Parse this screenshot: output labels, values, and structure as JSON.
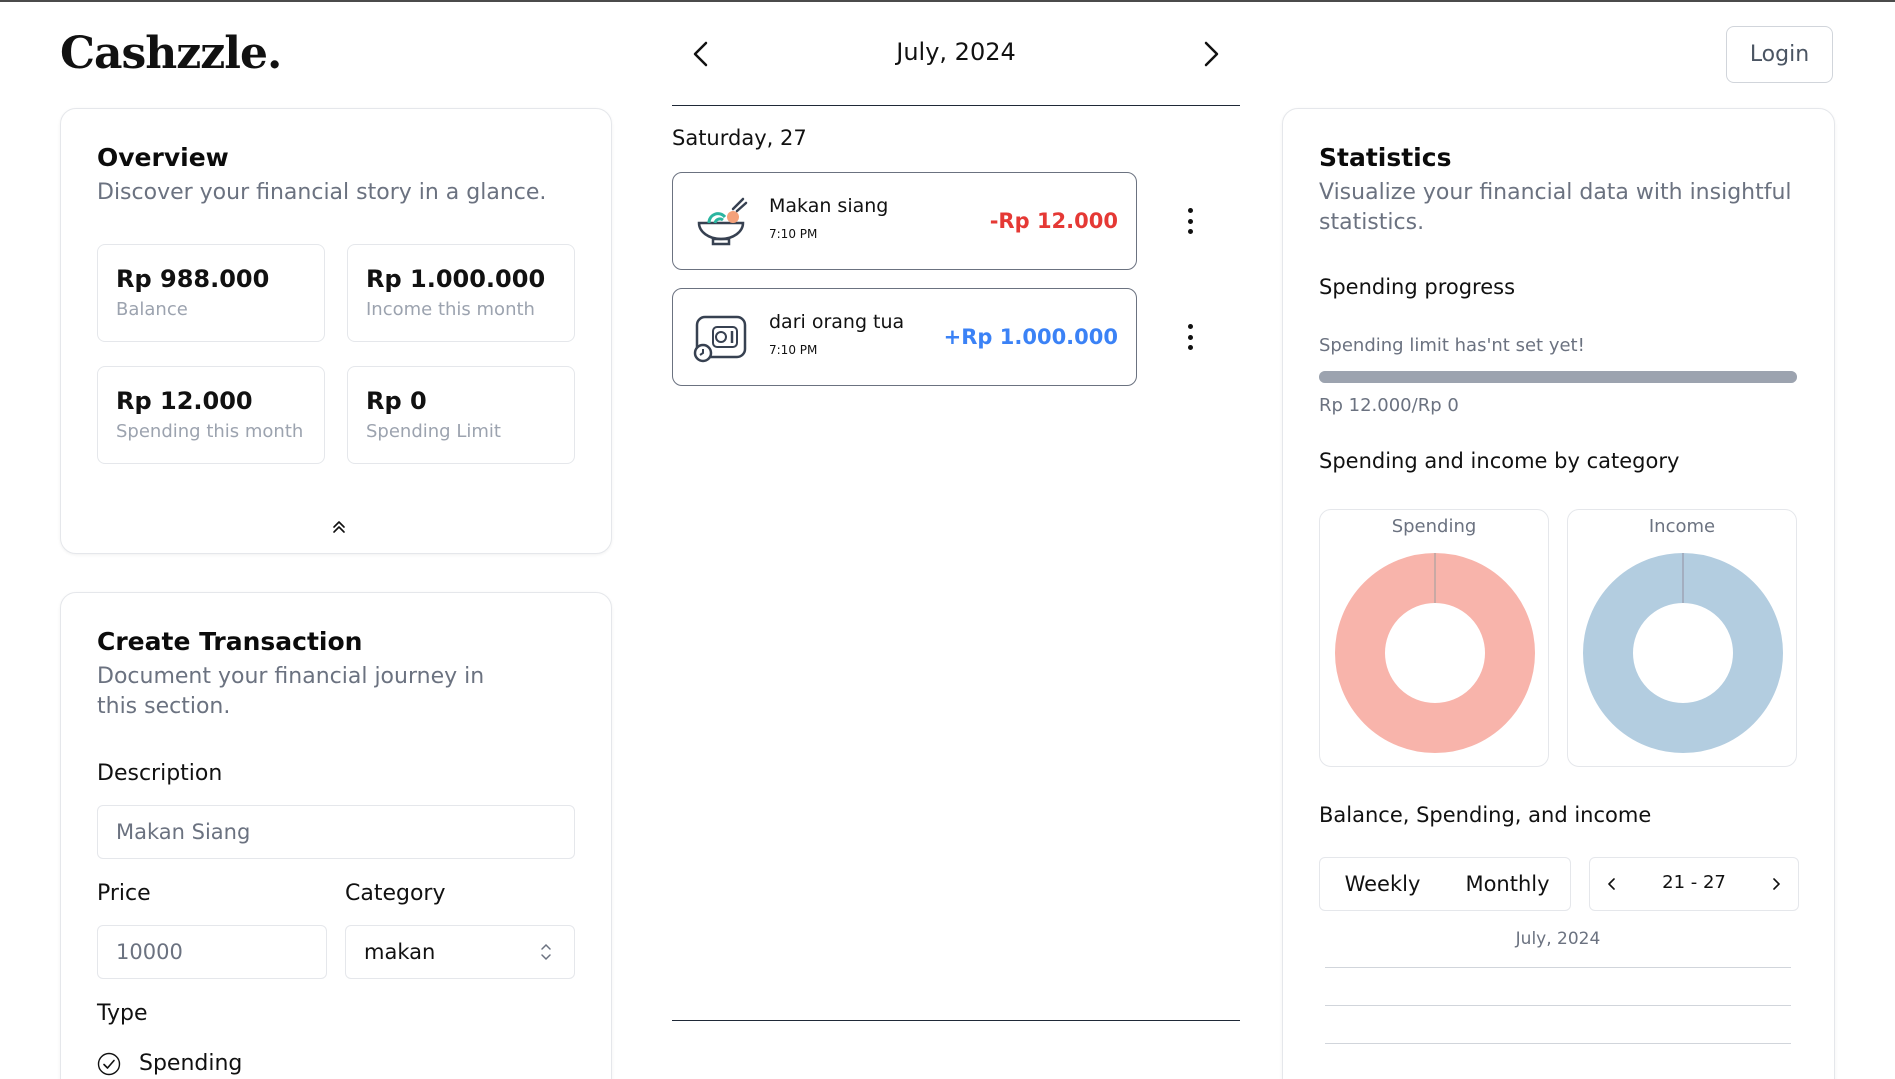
{
  "brand": "Cashzzle.",
  "login_label": "Login",
  "month_nav": {
    "label": "July, 2024"
  },
  "overview": {
    "title": "Overview",
    "subtitle": "Discover your financial story in a glance.",
    "stats": [
      {
        "value": "Rp 988.000",
        "label": "Balance"
      },
      {
        "value": "Rp 1.000.000",
        "label": "Income this month"
      },
      {
        "value": "Rp 12.000",
        "label": "Spending this month"
      },
      {
        "value": "Rp 0",
        "label": "Spending Limit"
      }
    ]
  },
  "create": {
    "title": "Create Transaction",
    "subtitle": "Document your financial journey in this section.",
    "description_label": "Description",
    "description_placeholder": "Makan Siang",
    "price_label": "Price",
    "price_placeholder": "10000",
    "category_label": "Category",
    "category_value": "makan",
    "type_label": "Type",
    "type_option": "Spending"
  },
  "transactions": {
    "day": "Saturday, 27",
    "items": [
      {
        "name": "Makan siang",
        "time": "7:10 PM",
        "amount": "-Rp 12.000",
        "color": "#e53935",
        "icon": "food-bowl-icon"
      },
      {
        "name": "dari orang tua",
        "time": "7:10 PM",
        "amount": "+Rp 1.000.000",
        "color": "#3b82f6",
        "icon": "wallet-icon"
      }
    ]
  },
  "statistics": {
    "title": "Statistics",
    "subtitle": "Visualize your financial data with insightful statistics.",
    "progress_title": "Spending progress",
    "progress_note": "Spending limit has'nt set yet!",
    "progress_text": "Rp 12.000/Rp 0",
    "progress_fraction": 1.0,
    "category_title": "Spending and income by category",
    "spending_caption": "Spending",
    "income_caption": "Income",
    "spending_color": "#f8b4ab",
    "income_color": "#b3cde0",
    "balance_title": "Balance, Spending, and income",
    "weekly_label": "Weekly",
    "monthly_label": "Monthly",
    "range_label": "21 - 27",
    "chart_month": "July, 2024"
  }
}
